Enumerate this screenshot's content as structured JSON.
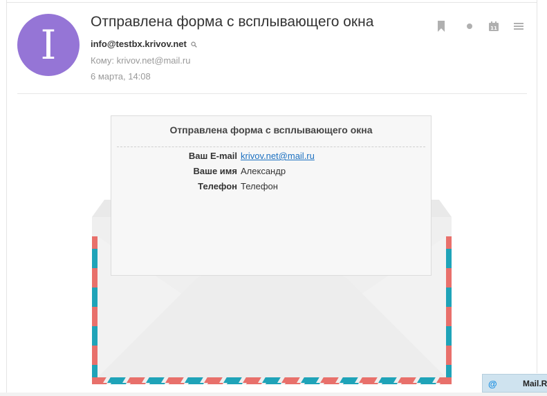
{
  "message": {
    "subject": "Отправлена форма с всплывающего окна",
    "avatar_letter": "I",
    "sender": "info@testbx.krivov.net",
    "recipient": "Кому: krivov.net@mail.ru",
    "date": "6 марта, 14:08"
  },
  "toolbar": {
    "icons": [
      "bookmark-icon",
      "unread-dot-icon",
      "calendar-icon",
      "menu-icon"
    ],
    "calendar_day": "11"
  },
  "form": {
    "title": "Отправлена форма с всплывающего окна",
    "fields": [
      {
        "label": "Ваш E-mail",
        "value": "krivov.net@mail.ru"
      },
      {
        "label": "Ваше имя",
        "value": "Александр"
      },
      {
        "label": "Телефон",
        "value": "Телефон"
      }
    ]
  },
  "mailru_tab": {
    "symbol": "@",
    "label": "Mail.R"
  },
  "colors": {
    "avatar": "#9575d6",
    "stripe_red": "#e8706b",
    "stripe_teal": "#1fa3b8",
    "link": "#1a6fc0",
    "icon_gray": "#b0b0b0"
  }
}
